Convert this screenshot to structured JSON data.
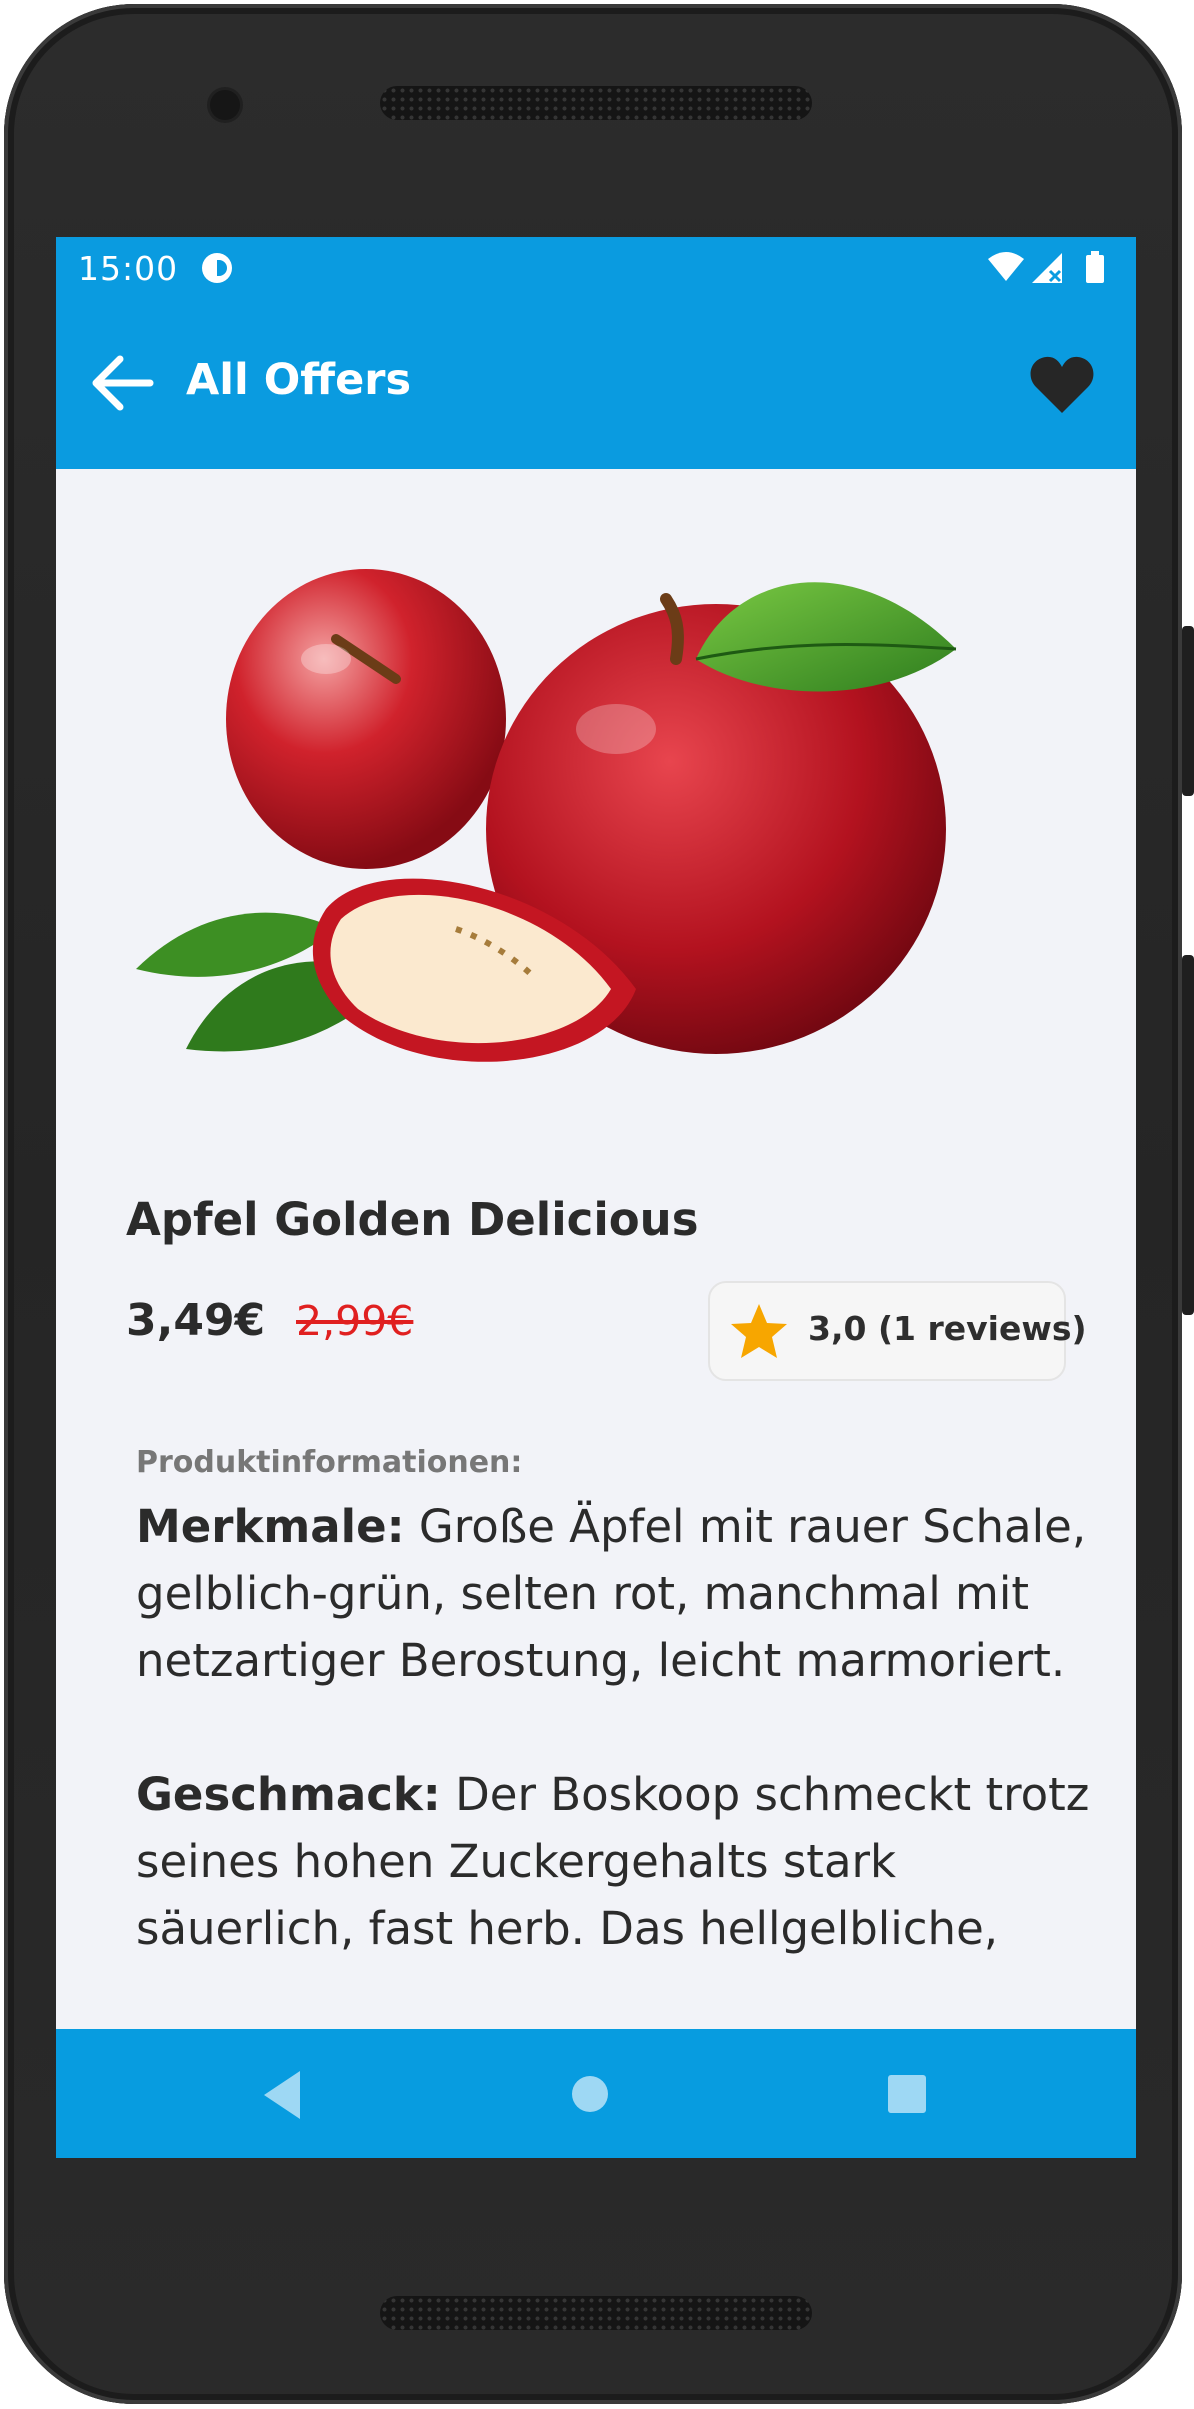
{
  "status_bar": {
    "time": "15:00",
    "icons": [
      "app-notification-icon",
      "wifi-icon",
      "signal-icon",
      "battery-icon"
    ]
  },
  "app_bar": {
    "title": "All Offers",
    "back_icon": "arrow-left-icon",
    "favorite_icon": "heart-icon"
  },
  "product": {
    "image": "red-apples-photo",
    "name": "Apfel Golden Delicious",
    "price": "3,49€",
    "old_price": "2,99€",
    "rating": {
      "star_icon": "star-icon",
      "text": "3,0 (1 reviews)"
    },
    "info": {
      "heading": "Produktinformationen:",
      "sections": [
        {
          "label": "Merkmale:",
          "text": " Große Äpfel mit rauer Schale, gelblich-grün, selten rot, manchmal mit netzartiger Berostung, leicht marmoriert."
        },
        {
          "label": "Geschmack:",
          "text": " Der Boskoop schmeckt trotz seines hohen Zuckergehalts stark säuerlich, fast herb. Das hellgelbliche,"
        }
      ]
    }
  },
  "nav_bar": {
    "icons": [
      "back-triangle-icon",
      "home-circle-icon",
      "recents-square-icon"
    ]
  },
  "colors": {
    "primary": "#0a9be0",
    "price_old": "#e02020",
    "star": "#f7a600",
    "background": "#f2f3f8"
  }
}
